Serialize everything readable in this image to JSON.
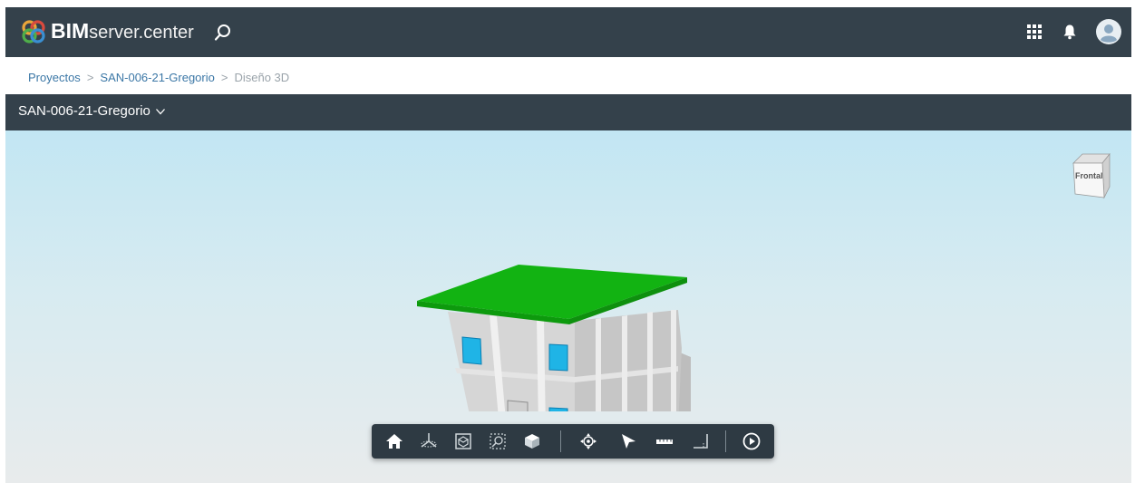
{
  "header": {
    "brand_bold": "BIM",
    "brand_rest": "server.center",
    "icons": [
      "logo-icon",
      "search-icon",
      "apps-grid-icon",
      "bell-icon",
      "user-avatar-icon"
    ]
  },
  "breadcrumb": {
    "items": [
      "Proyectos",
      "SAN-006-21-Gregorio",
      "Diseño 3D"
    ]
  },
  "project_bar": {
    "project_name": "SAN-006-21-Gregorio"
  },
  "viewer": {
    "viewcube_label": "Frontal",
    "colors": {
      "roof": "#12b312",
      "walls": "#cfcfcf",
      "windows": "#1fb4e6",
      "sky_top": "#c2e6f3",
      "sky_bottom": "#e8ebec"
    }
  },
  "toolbar": {
    "tools": [
      "home-icon",
      "orbit-axes-icon",
      "zoom-extents-icon",
      "zoom-window-icon",
      "section-box-icon",
      "navigation-icon",
      "select-pointer-icon",
      "measure-ruler-icon",
      "angle-measure-icon",
      "play-icon"
    ]
  }
}
